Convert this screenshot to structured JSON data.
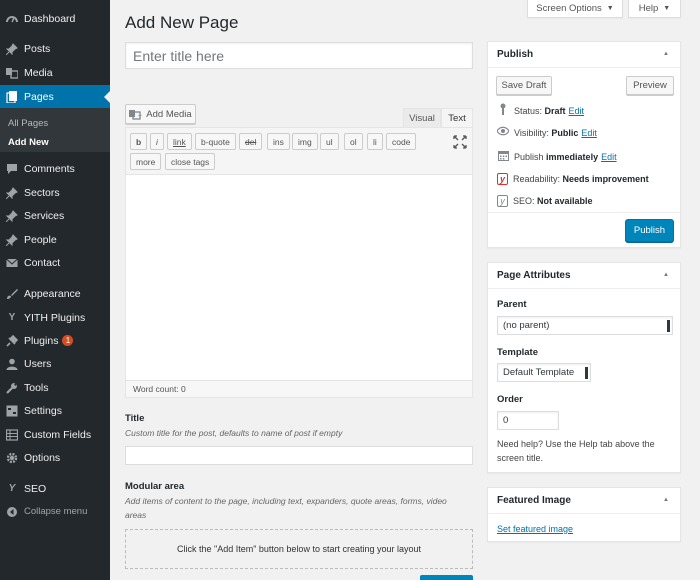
{
  "sidebar": {
    "items": [
      {
        "label": "Dashboard",
        "icon": "dashboard-icon"
      },
      {
        "label": "Posts",
        "icon": "pin-icon"
      },
      {
        "label": "Media",
        "icon": "media-icon"
      },
      {
        "label": "Pages",
        "icon": "pages-icon",
        "active": true
      },
      {
        "label": "Comments",
        "icon": "comment-icon"
      },
      {
        "label": "Sectors",
        "icon": "pin-icon"
      },
      {
        "label": "Services",
        "icon": "pin-icon"
      },
      {
        "label": "People",
        "icon": "pin-icon"
      },
      {
        "label": "Contact",
        "icon": "mail-icon"
      },
      {
        "label": "Appearance",
        "icon": "brush-icon"
      },
      {
        "label": "YITH Plugins",
        "icon": "yith-icon"
      },
      {
        "label": "Plugins",
        "icon": "plug-icon",
        "badge": "1"
      },
      {
        "label": "Users",
        "icon": "user-icon"
      },
      {
        "label": "Tools",
        "icon": "wrench-icon"
      },
      {
        "label": "Settings",
        "icon": "settings-icon"
      },
      {
        "label": "Custom Fields",
        "icon": "table-icon"
      },
      {
        "label": "Options",
        "icon": "gear-icon"
      },
      {
        "label": "SEO",
        "icon": "yoast-icon"
      }
    ],
    "submenu": [
      {
        "label": "All Pages"
      },
      {
        "label": "Add New",
        "current": true
      }
    ],
    "collapse_label": "Collapse menu"
  },
  "top_buttons": {
    "screen_options": "Screen Options",
    "help": "Help"
  },
  "page_title": "Add New Page",
  "title_field": {
    "placeholder": "Enter title here"
  },
  "editor": {
    "add_media": "Add Media",
    "tabs": {
      "visual": "Visual",
      "text": "Text"
    },
    "quicktags": [
      "b",
      "i",
      "link",
      "b-quote",
      "del",
      "ins",
      "img",
      "ul",
      "ol",
      "li",
      "code",
      "more",
      "close tags"
    ],
    "word_count": "Word count: 0"
  },
  "seo_title": {
    "label": "Title",
    "description": "Custom title for the post, defaults to name of post if empty"
  },
  "modular_area": {
    "label": "Modular area",
    "description": "Add items of content to the page, including text, expanders, quote areas, forms, video areas",
    "placeholder": "Click the \"Add Item\" button below to start creating your layout"
  },
  "publish_box": {
    "title": "Publish",
    "save_draft": "Save Draft",
    "preview": "Preview",
    "status_label": "Status:",
    "status_value": "Draft",
    "visibility_label": "Visibility:",
    "visibility_value": "Public",
    "publish_label": "Publish",
    "publish_value": "immediately",
    "edit": "Edit",
    "readability_label": "Readability:",
    "readability_value": "Needs improvement",
    "seo_label": "SEO:",
    "seo_value": "Not available",
    "publish_button": "Publish"
  },
  "page_attributes": {
    "title": "Page Attributes",
    "parent_label": "Parent",
    "parent_value": "(no parent)",
    "template_label": "Template",
    "template_value": "Default Template",
    "order_label": "Order",
    "order_value": "0",
    "help_text": "Need help? Use the Help tab above the screen title."
  },
  "featured_image": {
    "title": "Featured Image",
    "link": "Set featured image"
  },
  "colors": {
    "sidebar_bg": "#23282d",
    "active_blue": "#0073aa",
    "primary_button": "#0085ba",
    "yoast_red": "#dc3232"
  }
}
